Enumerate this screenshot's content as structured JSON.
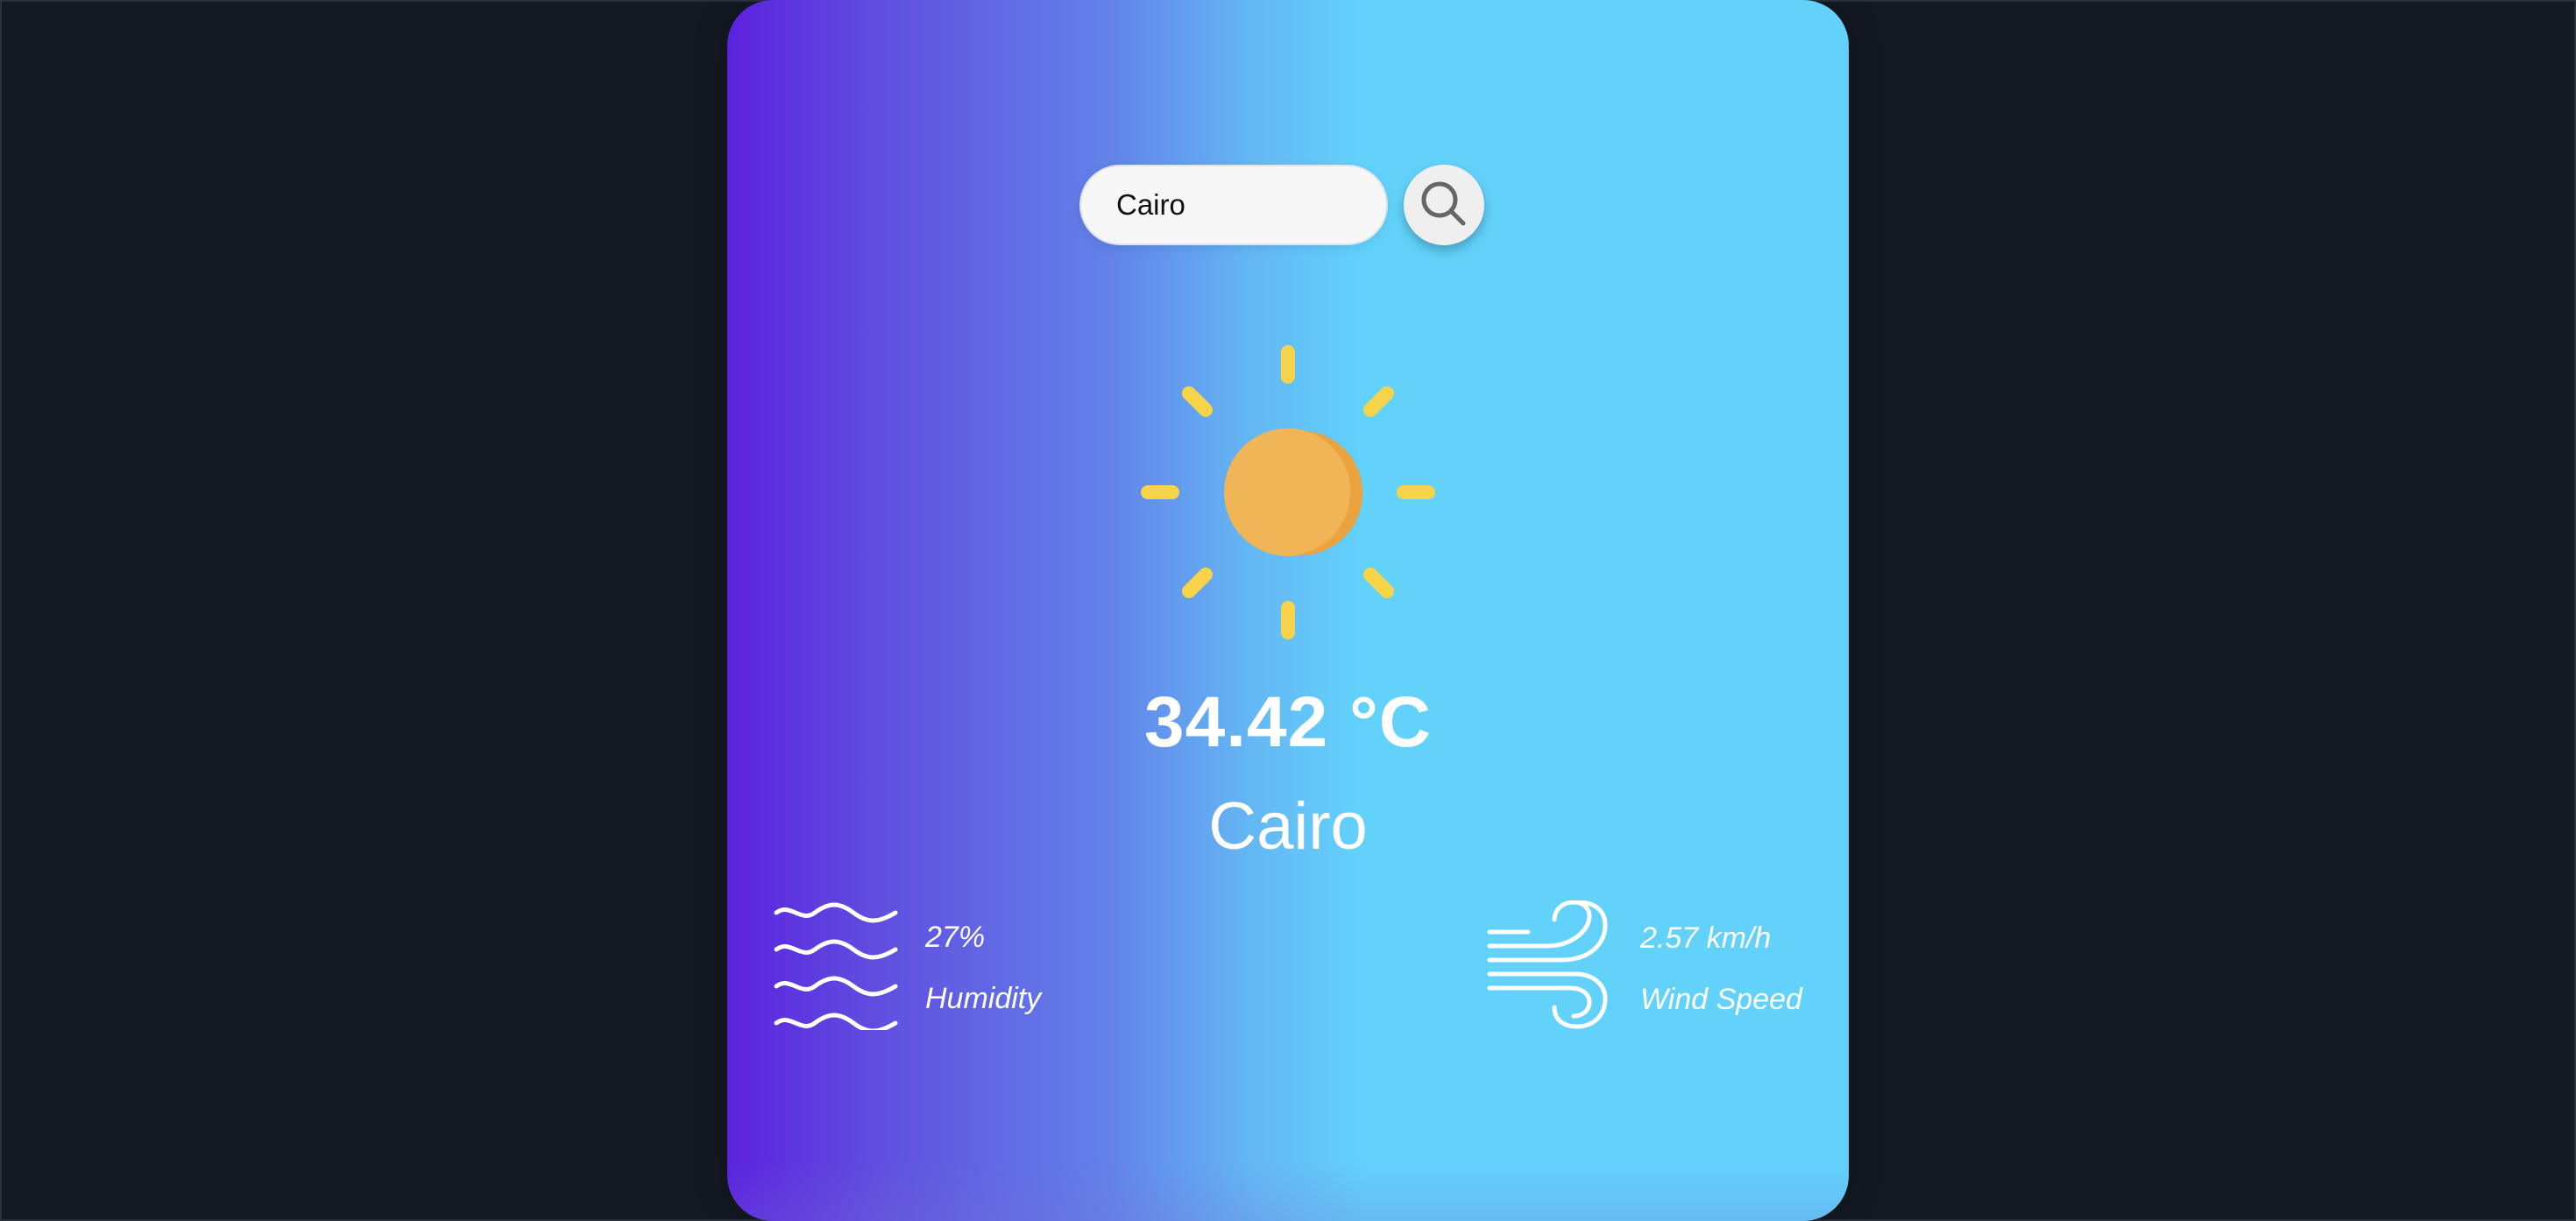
{
  "search": {
    "value": "Cairo",
    "placeholder": ""
  },
  "weather": {
    "icon": "sun-icon",
    "temperature": "34.42 °C",
    "city": "Cairo",
    "humidity_value": "27%",
    "humidity_label": "Humidity",
    "wind_value": "2.57 km/h",
    "wind_label": "Wind Speed"
  },
  "icons": {
    "search": "search-icon",
    "humidity": "humidity-waves-icon",
    "wind": "wind-icon"
  },
  "colors": {
    "page_background": "#131922",
    "gradient_start": "#5b22de",
    "gradient_end": "#62d2fb",
    "sun_core": "#f0b450",
    "sun_rays": "#f7d34a"
  }
}
